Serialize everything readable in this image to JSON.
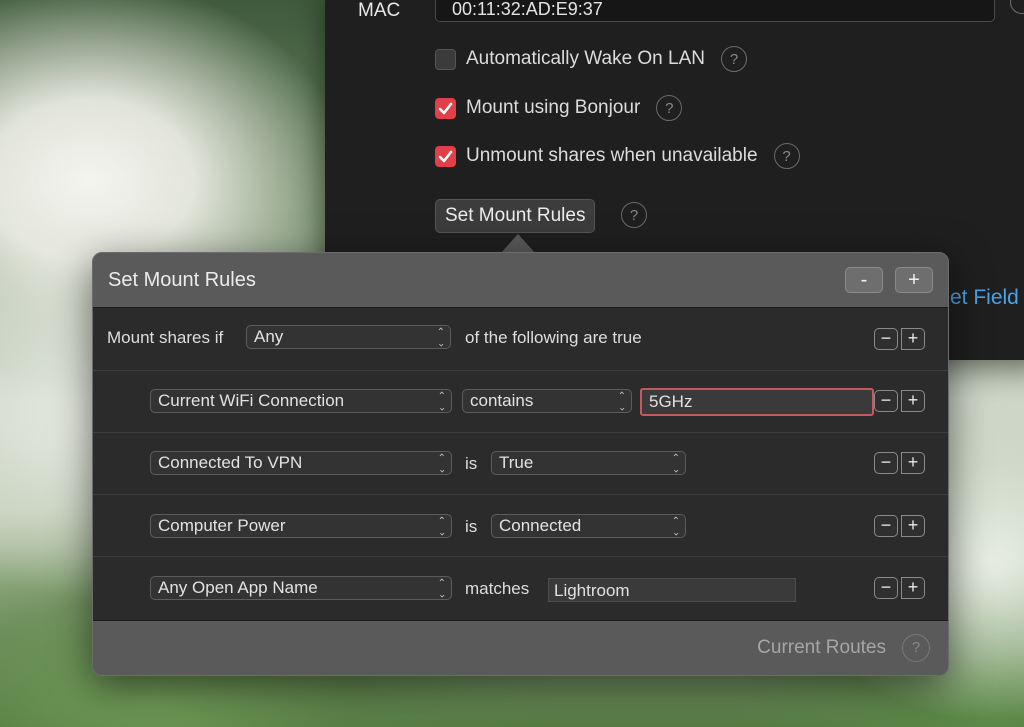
{
  "settings": {
    "mac_label": "MAC",
    "mac_value": "00:11:32:AD:E9:37",
    "options": [
      {
        "label": "Automatically Wake On LAN",
        "checked": false
      },
      {
        "label": "Mount using Bonjour",
        "checked": true
      },
      {
        "label": "Unmount shares when unavailable",
        "checked": true
      }
    ],
    "set_rules_button": "Set Mount Rules",
    "partial_link": "et Field",
    "help_glyph": "?"
  },
  "popover": {
    "title": "Set Mount Rules",
    "remove_label": "-",
    "add_label": "+",
    "match_prefix": "Mount shares if",
    "match_mode": "Any",
    "match_suffix": "of the following are true",
    "rules": [
      {
        "field": "Current WiFi Connection",
        "operator": "contains",
        "value": "5GHz"
      },
      {
        "field": "Connected To VPN",
        "operator": "is",
        "value": "True"
      },
      {
        "field": "Computer Power",
        "operator": "is",
        "value": "Connected"
      },
      {
        "field": "Any Open App Name",
        "operator": "matches",
        "value": "Lightroom"
      }
    ],
    "row_remove": "−",
    "row_add": "+",
    "footer_label": "Current Routes"
  },
  "colors": {
    "checkbox_accent": "#e0404a",
    "link_blue": "#4aa3e8",
    "focus_ring": "#c45a5e"
  }
}
